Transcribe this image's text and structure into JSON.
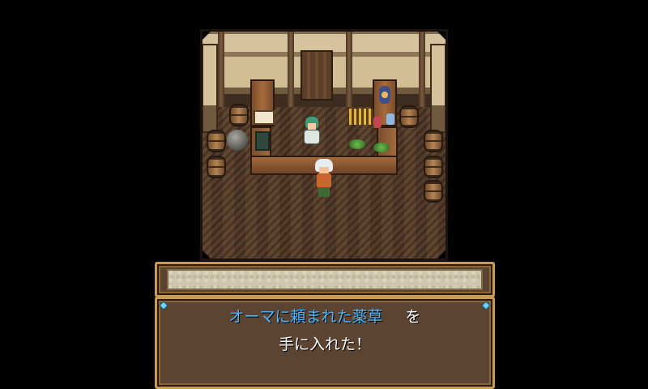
{
  "dialogue": {
    "speaker_name": "",
    "item_name": "オーマに頼まれた薬草",
    "particle": "を",
    "line2": "手に入れた！"
  },
  "colors": {
    "item_highlight": "#4db7ff",
    "text": "#ffffff",
    "frame_gold": "#c99b58",
    "dialog_bg": "#5b4432"
  },
  "scene": {
    "npc_role": "shopkeeper",
    "player_icon": "hero-sprite",
    "npc_icon": "shopkeeper-sprite"
  }
}
